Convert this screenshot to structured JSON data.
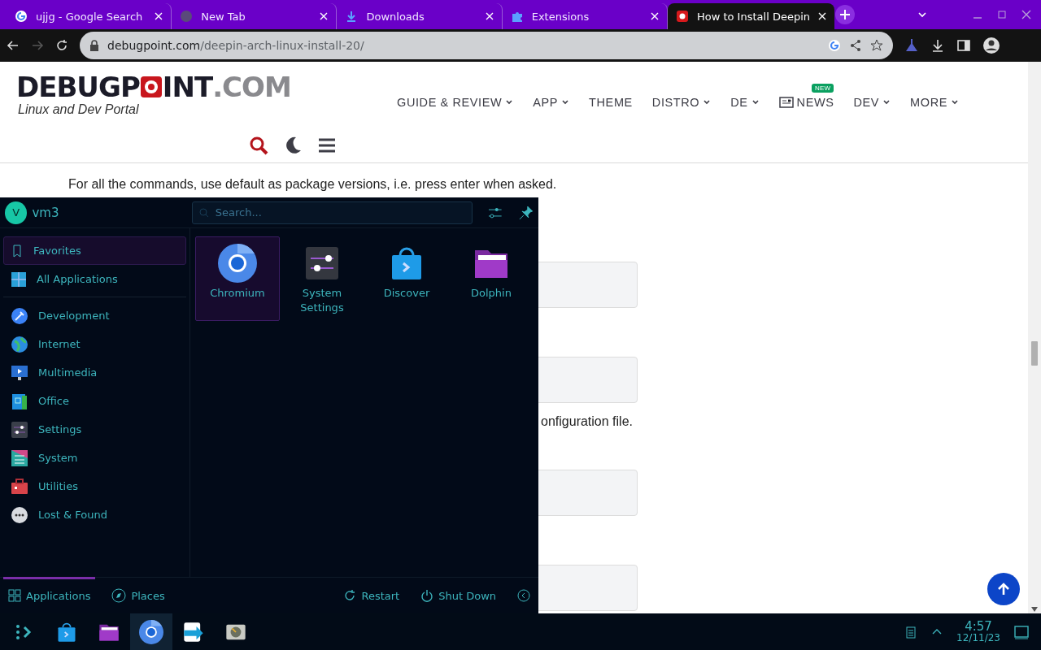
{
  "browser": {
    "tabs": [
      {
        "title": "ujjg - Google Search",
        "kind": "google",
        "selected": false
      },
      {
        "title": "New Tab",
        "kind": "newtab",
        "selected": false
      },
      {
        "title": "Downloads",
        "kind": "download",
        "selected": false
      },
      {
        "title": "Extensions",
        "kind": "puzzle",
        "selected": false
      },
      {
        "title": "How to Install Deepin",
        "kind": "record",
        "selected": true
      }
    ],
    "address": {
      "domain": "debugpoint.com",
      "path": "/deepin-arch-linux-install-20/"
    }
  },
  "site": {
    "logo": {
      "before": "DEBUGP",
      "after": "INT",
      "suffix": ".COM",
      "tagline": "Linux and Dev Portal"
    },
    "nav": [
      {
        "label": "GUIDE & REVIEW",
        "dropdown": true
      },
      {
        "label": "APP",
        "dropdown": true
      },
      {
        "label": "THEME",
        "dropdown": false
      },
      {
        "label": "DISTRO",
        "dropdown": true
      },
      {
        "label": "DE",
        "dropdown": true
      },
      {
        "label": "NEWS",
        "dropdown": false,
        "badge": "NEW"
      },
      {
        "label": "DEV",
        "dropdown": true
      },
      {
        "label": "MORE",
        "dropdown": true
      }
    ],
    "content": [
      {
        "kind": "text",
        "text": "For all the commands, use default as package versions, i.e. press enter when asked."
      },
      {
        "kind": "code"
      },
      {
        "kind": "code"
      },
      {
        "kind": "tail",
        "text": "onfiguration file."
      },
      {
        "kind": "code"
      },
      {
        "kind": "code"
      }
    ]
  },
  "launcher": {
    "user": {
      "initial": "V",
      "name": "vm3"
    },
    "search": {
      "placeholder": "Search..."
    },
    "views": [
      {
        "label": "Favorites",
        "selected": true
      },
      {
        "label": "All Applications",
        "selected": false
      }
    ],
    "categories": [
      {
        "label": "Development",
        "selected": false
      },
      {
        "label": "Internet",
        "selected": false
      },
      {
        "label": "Multimedia",
        "selected": false
      },
      {
        "label": "Office",
        "selected": false
      },
      {
        "label": "Settings",
        "selected": false
      },
      {
        "label": "System",
        "selected": false
      },
      {
        "label": "Utilities",
        "selected": false
      },
      {
        "label": "Lost & Found",
        "selected": false
      }
    ],
    "apps": [
      {
        "name": "Chromium",
        "kind": "chromium",
        "selected": true
      },
      {
        "name": "System Settings",
        "kind": "settings",
        "selected": false
      },
      {
        "name": "Discover",
        "kind": "bag",
        "selected": false
      },
      {
        "name": "Dolphin",
        "kind": "folder",
        "selected": false
      }
    ],
    "footer_tabs": [
      {
        "label": "Applications",
        "kind": "grid",
        "selected": true
      },
      {
        "label": "Places",
        "kind": "compass",
        "selected": false
      }
    ],
    "actions": [
      {
        "label": "Restart",
        "kind": "restart"
      },
      {
        "label": "Shut Down",
        "kind": "power"
      }
    ]
  },
  "taskbar": {
    "apps": [
      {
        "kind": "launcher",
        "selected": false
      },
      {
        "kind": "bag",
        "selected": false
      },
      {
        "kind": "folder",
        "selected": false
      },
      {
        "kind": "chromium",
        "selected": true
      },
      {
        "kind": "arrow",
        "selected": false
      },
      {
        "kind": "disk",
        "selected": false
      }
    ],
    "clock": {
      "time": "4:57",
      "date": "12/11/23"
    }
  }
}
